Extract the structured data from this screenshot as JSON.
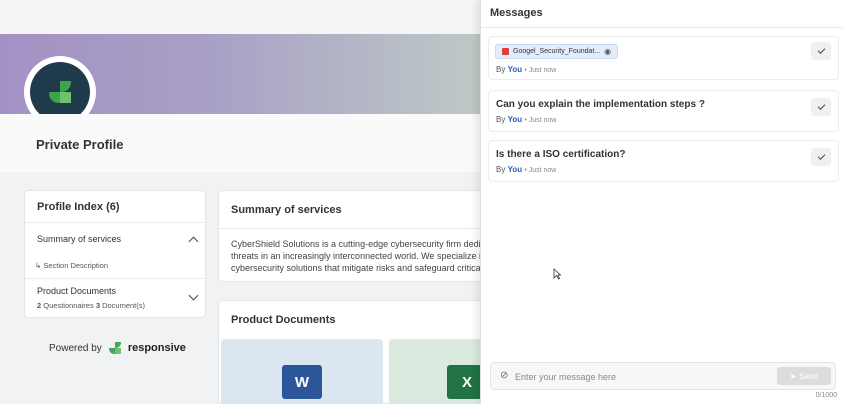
{
  "profile": {
    "title": "Private Profile",
    "index_title": "Profile Index (6)",
    "index_items": [
      {
        "label": "Summary of services",
        "sub": "Section Description"
      },
      {
        "label": "Product Documents",
        "meta_count1": "2",
        "meta_label1": "Questionnaires",
        "meta_count2": "3",
        "meta_label2": "Document(s)"
      }
    ],
    "powered_by": "Powered by",
    "brand": "responsive"
  },
  "summary": {
    "title": "Summary of services",
    "lines": [
      "CyberShield Solutions is a cutting-edge cybersecurity firm dedi",
      "threats in an increasingly interconnected world. We specialize i",
      "cybersecurity solutions that mitigate risks and safeguard critica"
    ]
  },
  "documents": {
    "title": "Product Documents",
    "tiles": [
      {
        "icon": "word-icon",
        "letter": "W",
        "color": "#2b579a"
      },
      {
        "icon": "excel-icon",
        "letter": "X",
        "color": "#217346"
      }
    ]
  },
  "messages": {
    "title": "Messages",
    "items": [
      {
        "attachment": "Googel_Security_Foundat...",
        "by": "By",
        "author": "You",
        "time": "• Just now"
      },
      {
        "text": "Can you explain the implementation steps ?",
        "by": "By",
        "author": "You",
        "time": "• Just now"
      },
      {
        "text": "Is there a ISO certification?",
        "by": "By",
        "author": "You",
        "time": "• Just now"
      }
    ],
    "input_placeholder": "Enter your message here",
    "send_label": "Send",
    "counter": "0/1000"
  },
  "colors": {
    "accent_blue": "#2c5fb0",
    "brand_green": "#4aa35a"
  }
}
